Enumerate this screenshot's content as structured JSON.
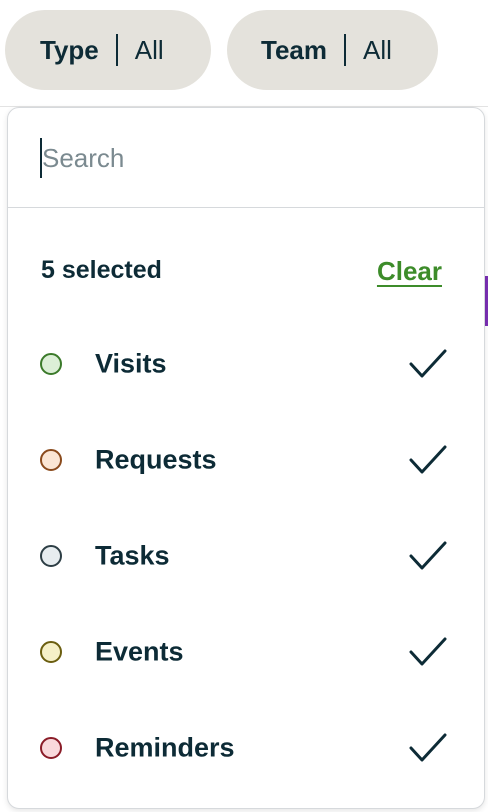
{
  "filters": [
    {
      "label": "Type",
      "value": "All"
    },
    {
      "label": "Team",
      "value": "All"
    }
  ],
  "dropdown": {
    "search_placeholder": "Search",
    "selected_summary": "5 selected",
    "clear_label": "Clear",
    "options": [
      {
        "label": "Visits",
        "selected": true,
        "dot_fill": "#dcefd7",
        "dot_border": "#3b7a2a"
      },
      {
        "label": "Requests",
        "selected": true,
        "dot_fill": "#fbe6d4",
        "dot_border": "#8a4a1c"
      },
      {
        "label": "Tasks",
        "selected": true,
        "dot_fill": "#e7edf0",
        "dot_border": "#2d3e45"
      },
      {
        "label": "Events",
        "selected": true,
        "dot_fill": "#f6f0c8",
        "dot_border": "#6b5e10"
      },
      {
        "label": "Reminders",
        "selected": true,
        "dot_fill": "#f9d9dc",
        "dot_border": "#8a1c28"
      }
    ]
  },
  "colors": {
    "text": "#0d2b36",
    "pill_bg": "#e4e2dc",
    "link_green": "#3d8c2a",
    "accent_purple": "#7a2fb3"
  },
  "icons": {
    "check": "checkmark-icon"
  }
}
